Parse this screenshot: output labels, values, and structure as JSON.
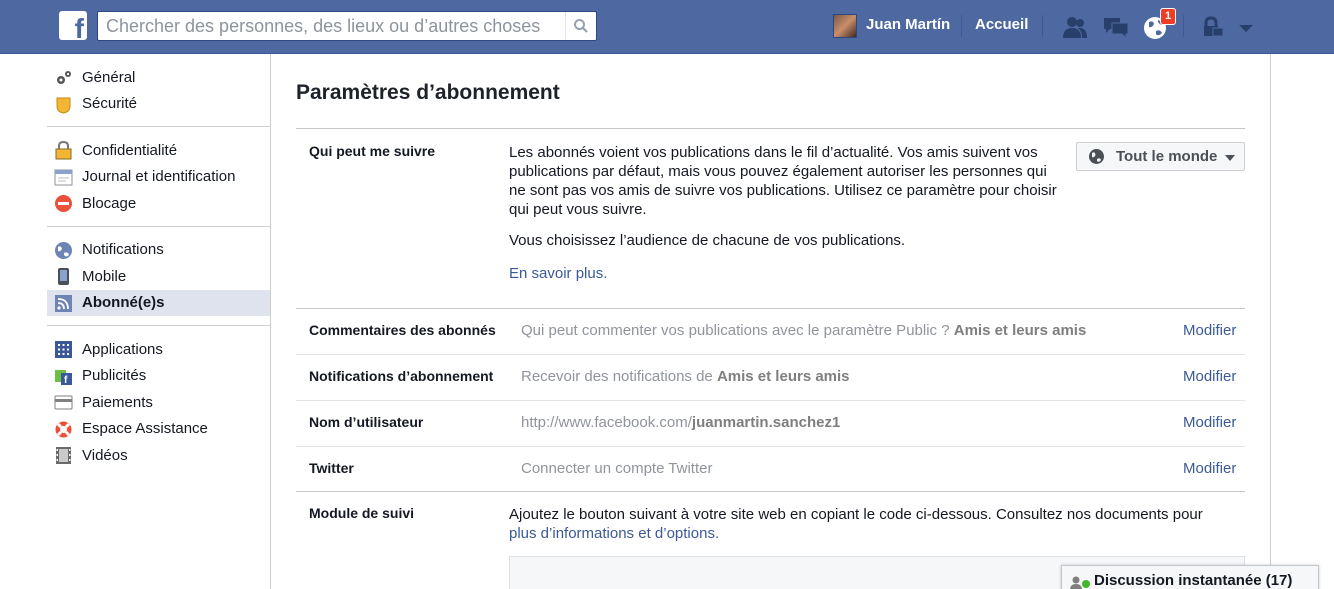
{
  "header": {
    "logo_letter": "f",
    "search_placeholder": "Chercher des personnes, des lieux ou d’autres choses",
    "user_name": "Juan Martín",
    "home_label": "Accueil",
    "notification_count": "1"
  },
  "sidebar": {
    "groups": [
      [
        {
          "label": "Général",
          "icon": "gear-icon"
        },
        {
          "label": "Sécurité",
          "icon": "badge-icon"
        }
      ],
      [
        {
          "label": "Confidentialité",
          "icon": "lock-icon"
        },
        {
          "label": "Journal et identification",
          "icon": "timeline-icon"
        },
        {
          "label": "Blocage",
          "icon": "block-icon"
        }
      ],
      [
        {
          "label": "Notifications",
          "icon": "globe-icon"
        },
        {
          "label": "Mobile",
          "icon": "phone-icon"
        },
        {
          "label": "Abonné(e)s",
          "icon": "rss-icon",
          "active": true
        }
      ],
      [
        {
          "label": "Applications",
          "icon": "apps-icon"
        },
        {
          "label": "Publicités",
          "icon": "ads-icon"
        },
        {
          "label": "Paiements",
          "icon": "card-icon"
        },
        {
          "label": "Espace Assistance",
          "icon": "lifebuoy-icon"
        },
        {
          "label": "Vidéos",
          "icon": "film-icon"
        }
      ]
    ]
  },
  "main": {
    "title": "Paramètres d’abonnement",
    "who_can_follow": {
      "label": "Qui peut me suivre",
      "desc1": "Les abonnés voient vos publications dans le fil d’actualité. Vos amis suivent vos publications par défaut, mais vous pouvez également autoriser les personnes qui ne sont pas vos amis de suivre vos publications. Utilisez ce paramètre pour choisir qui peut vous suivre.",
      "desc2": "Vous choisissez l’audience de chacune de vos publications.",
      "learn_more": "En savoir plus.",
      "dropdown_value": "Tout le monde"
    },
    "rows": [
      {
        "label": "Commentaires des abonnés",
        "text": "Qui peut commenter vos publications avec le paramètre Public ?",
        "bold": "Amis et leurs amis",
        "action": "Modifier"
      },
      {
        "label": "Notifications d’abonnement",
        "text": "Recevoir des notifications de",
        "bold": "Amis et leurs amis",
        "action": "Modifier"
      },
      {
        "label": "Nom d’utilisateur",
        "text": "http://www.facebook.com/",
        "bold": "juanmartin.sanchez1",
        "action": "Modifier"
      },
      {
        "label": "Twitter",
        "text": "Connecter un compte Twitter",
        "bold": "",
        "action": "Modifier"
      }
    ],
    "follow_module": {
      "label": "Module de suivi",
      "text": "Ajoutez le bouton suivant à votre site web en copiant le code ci-dessous. Consultez nos documents pour",
      "link": "plus d’informations et d’options."
    }
  },
  "chat": {
    "label": "Discussion instantanée (17)"
  }
}
